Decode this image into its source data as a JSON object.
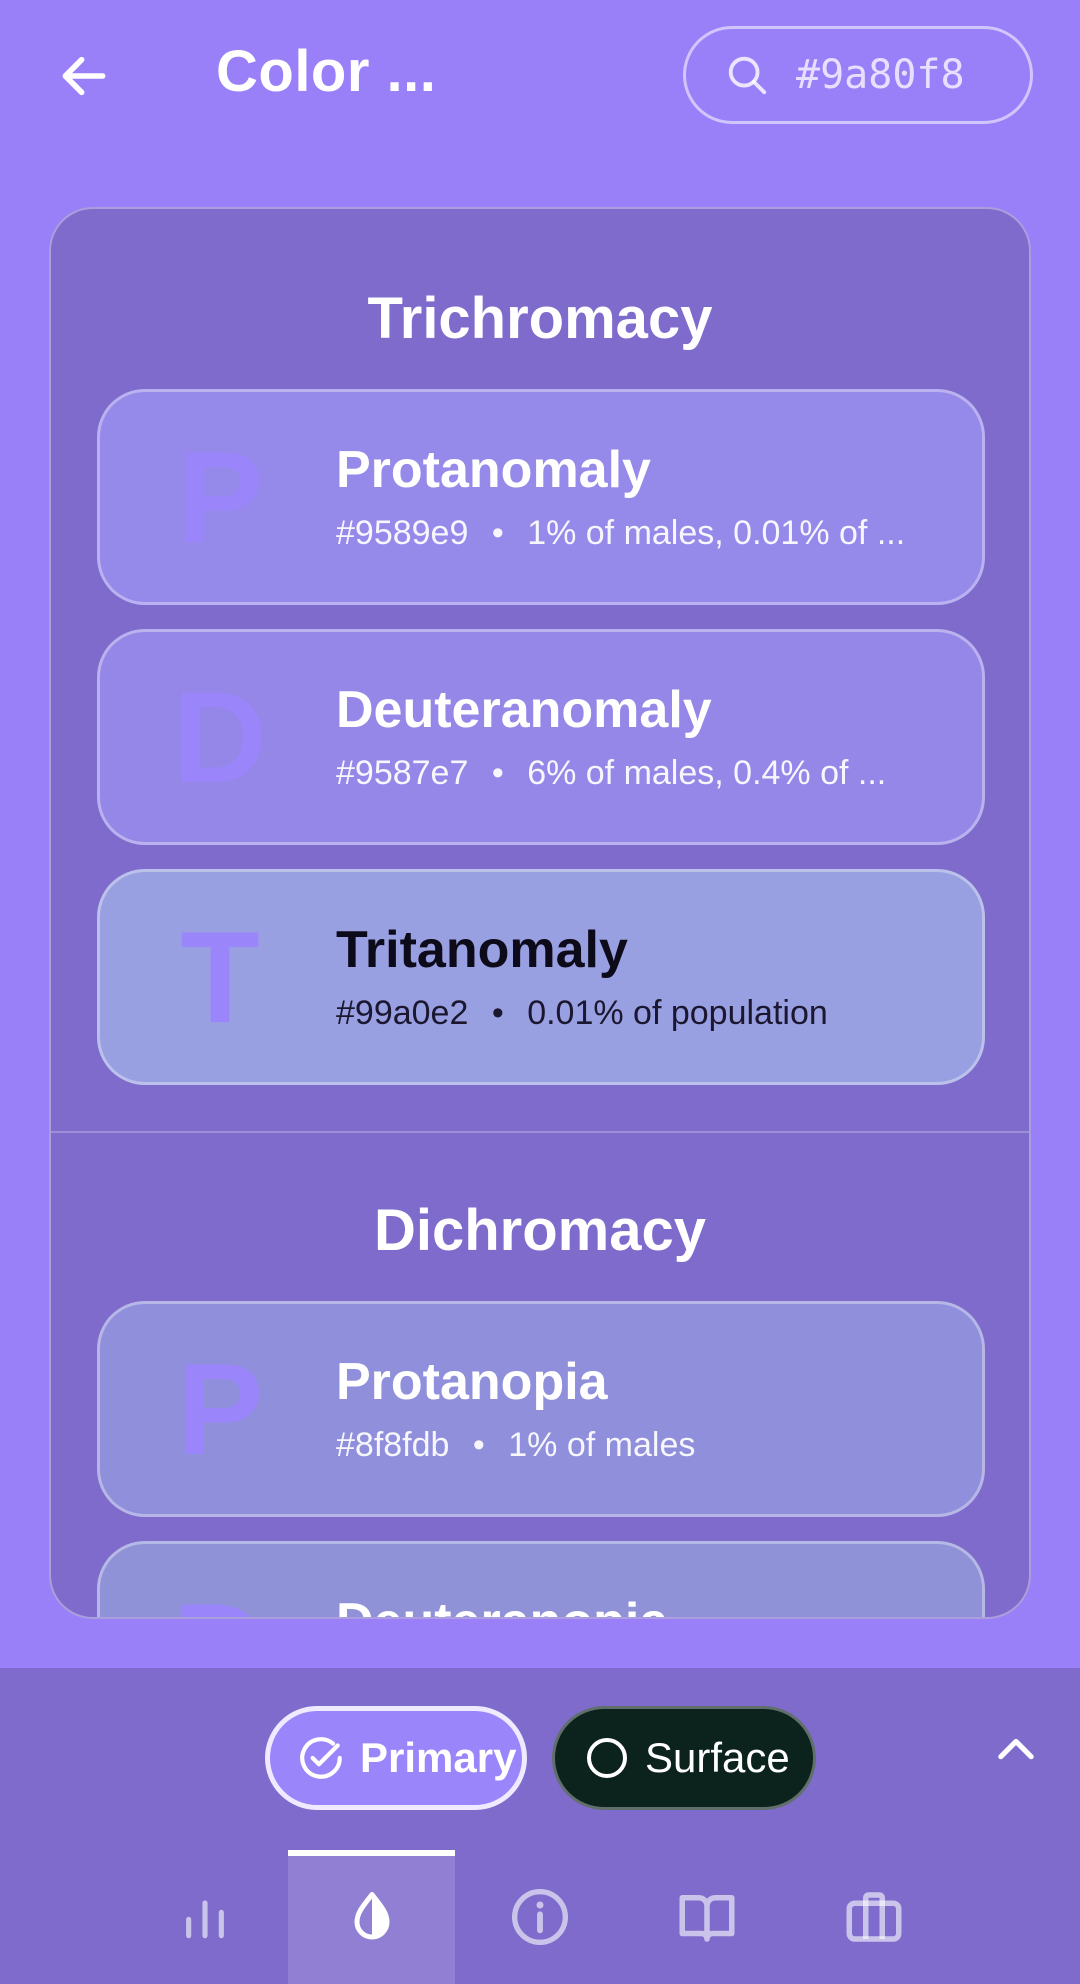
{
  "header": {
    "title": "Color ...",
    "back_icon": "arrow-left-icon",
    "search": {
      "icon": "search-icon",
      "value": "#9a80f8"
    }
  },
  "sections": [
    {
      "title": "Trichromacy",
      "items": [
        {
          "letter": "P",
          "name": "Protanomaly",
          "hex": "#9589e9",
          "description": "1% of males, 0.01% of ...",
          "background": "#9589e9"
        },
        {
          "letter": "D",
          "name": "Deuteranomaly",
          "hex": "#9587e7",
          "description": "6% of males, 0.4% of ...",
          "background": "#9587e7"
        },
        {
          "letter": "T",
          "name": "Tritanomaly",
          "hex": "#99a0e2",
          "description": "0.01% of population",
          "background": "#99a0e2"
        }
      ]
    },
    {
      "title": "Dichromacy",
      "items": [
        {
          "letter": "P",
          "name": "Protanopia",
          "hex": "#8f8fdb",
          "description": "1% of males",
          "background": "#8f8fdb"
        },
        {
          "letter": "D",
          "name": "Deuteranopia",
          "hex": "",
          "description": "",
          "background": "#8f92d7"
        }
      ]
    }
  ],
  "separator": "•",
  "controls": {
    "primary_chip": {
      "label": "Primary",
      "icon": "check-circle-icon",
      "selected": true
    },
    "surface_chip": {
      "label": "Surface",
      "icon": "circle-icon",
      "selected": false
    },
    "expand_icon": "chevron-up-icon"
  },
  "bottom_nav": [
    {
      "icon": "bar-chart-icon",
      "active": false
    },
    {
      "icon": "water-drop-icon",
      "active": true
    },
    {
      "icon": "info-icon",
      "active": false
    },
    {
      "icon": "book-icon",
      "active": false
    },
    {
      "icon": "briefcase-icon",
      "active": false
    }
  ],
  "colors": {
    "background": "#9a80f8",
    "panel": "#7e6bcb",
    "accent": "#9b85fb",
    "surface_chip": "#0b231c",
    "text": "#ffffff"
  }
}
